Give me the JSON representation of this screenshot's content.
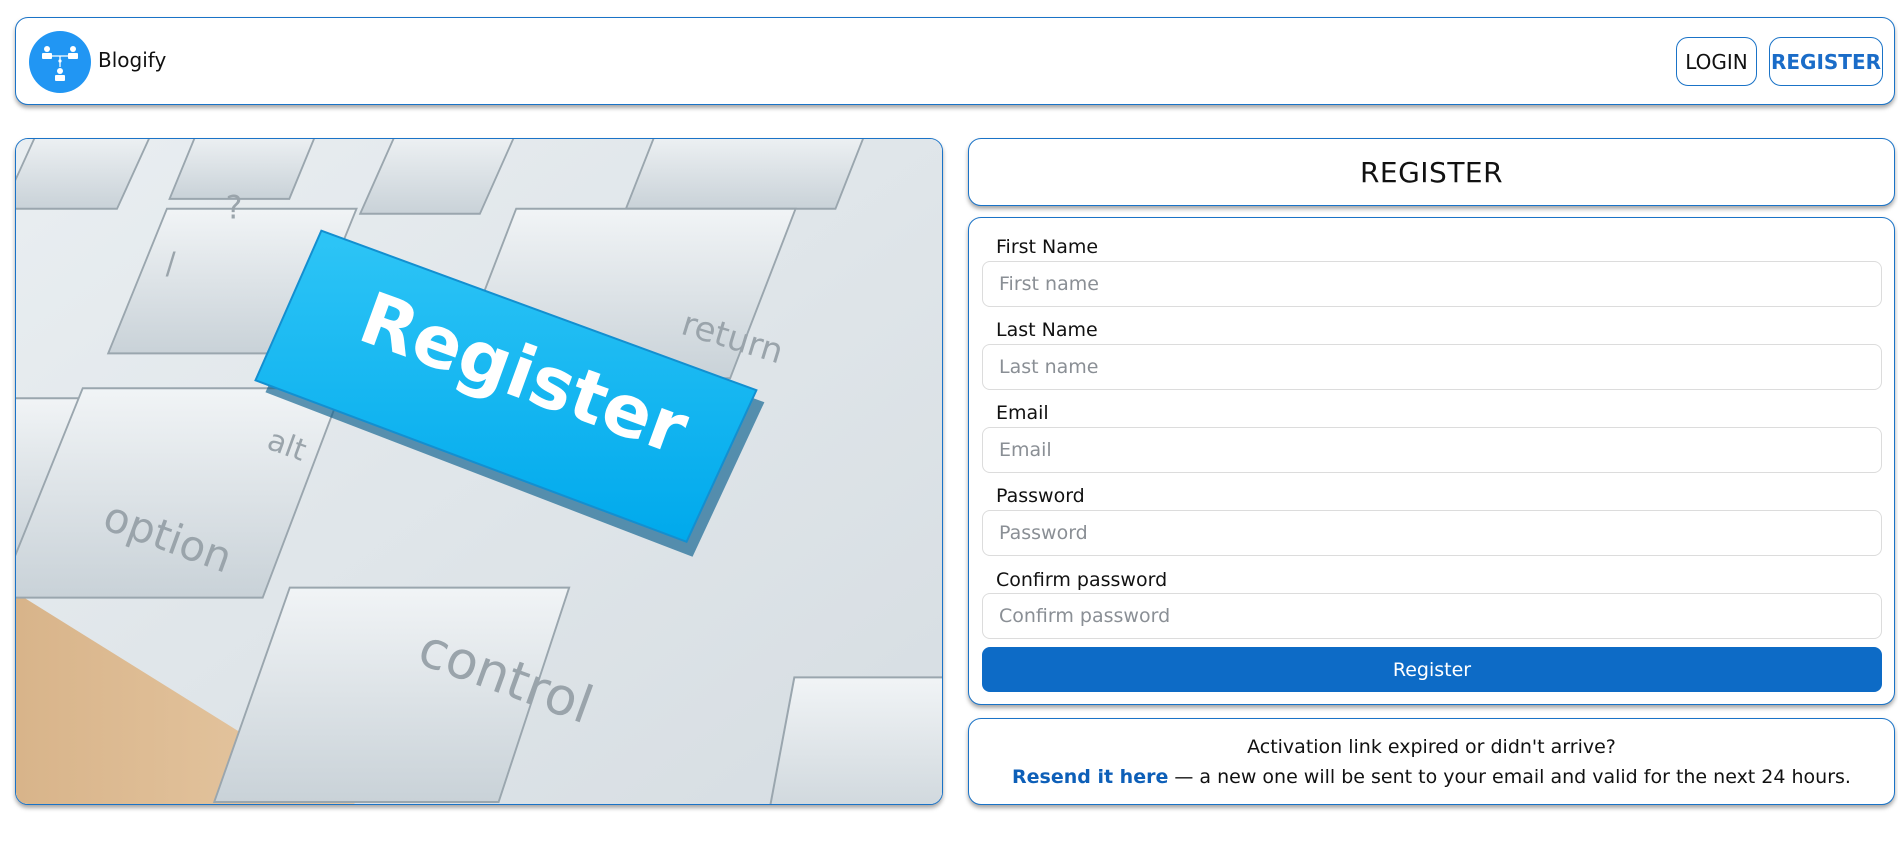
{
  "header": {
    "logo_icon": "network-people-icon",
    "brand": "Blogify",
    "login_label": "LOGIN",
    "register_label": "REGISTER"
  },
  "hero": {
    "description_icon": "keyboard-register-key-image",
    "key_labels": {
      "register": "Register",
      "return": "return",
      "alt": "alt",
      "option": "option",
      "control": "control",
      "question": "?",
      "slash": "/"
    }
  },
  "register": {
    "title": "REGISTER"
  },
  "form": {
    "first_name_label": "First Name",
    "first_name_placeholder": "First name",
    "last_name_label": "Last Name",
    "last_name_placeholder": "Last name",
    "email_label": "Email",
    "email_placeholder": "Email",
    "password_label": "Password",
    "password_placeholder": "Password",
    "confirm_label": "Confirm password",
    "confirm_placeholder": "Confirm password",
    "submit_label": "Register"
  },
  "resend": {
    "question": "Activation link expired or didn't arrive?",
    "link_text": "Resend it here",
    "rest_text": " — a new one will be sent to your email and valid for the next 24 hours."
  },
  "colors": {
    "accent": "#1a73c7",
    "button": "#0d6bc6",
    "logo_bg": "#2196f3"
  }
}
